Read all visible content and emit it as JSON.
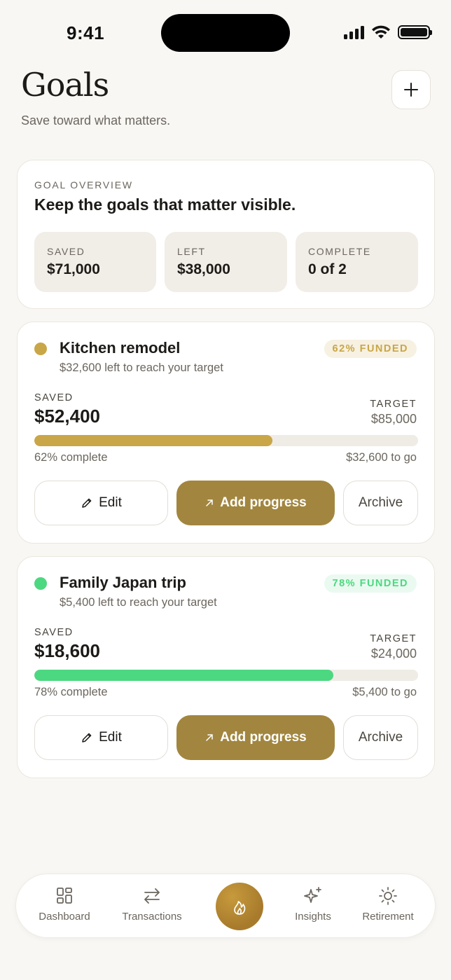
{
  "status": {
    "time": "9:41"
  },
  "header": {
    "title": "Goals",
    "subtitle": "Save toward what matters.",
    "add_icon": "plus-icon"
  },
  "overview": {
    "eyebrow": "GOAL OVERVIEW",
    "heading": "Keep the goals that matter visible.",
    "stats": [
      {
        "label": "SAVED",
        "value": "$71,000"
      },
      {
        "label": "LEFT",
        "value": "$38,000"
      },
      {
        "label": "COMPLETE",
        "value": "0 of 2"
      }
    ]
  },
  "goals": [
    {
      "name": "Kitchen remodel",
      "subtitle": "$32,600 left to reach your target",
      "badge": "62% FUNDED",
      "saved_label": "SAVED",
      "saved": "$52,400",
      "target_label": "TARGET",
      "target": "$85,000",
      "progress": 0.62,
      "progress_text": "62% complete",
      "remaining_text": "$32,600 to go",
      "color": "#c9a647",
      "badge_bg": "#f7f1e2",
      "badge_color": "#c9a647",
      "edit_label": "Edit",
      "add_label": "Add progress",
      "archive_label": "Archive"
    },
    {
      "name": "Family Japan trip",
      "subtitle": "$5,400 left to reach your target",
      "badge": "78% FUNDED",
      "saved_label": "SAVED",
      "saved": "$18,600",
      "target_label": "TARGET",
      "target": "$24,000",
      "progress": 0.78,
      "progress_text": "78% complete",
      "remaining_text": "$5,400 to go",
      "color": "#4cd880",
      "badge_bg": "#eafaf0",
      "badge_color": "#4cd880",
      "edit_label": "Edit",
      "add_label": "Add progress",
      "archive_label": "Archive"
    }
  ],
  "tabbar": {
    "items": [
      {
        "label": "Dashboard",
        "icon": "grid-icon"
      },
      {
        "label": "Transactions",
        "icon": "arrows-icon"
      },
      {
        "label": "",
        "icon": "flame-icon"
      },
      {
        "label": "Insights",
        "icon": "sparkle-icon"
      },
      {
        "label": "Retirement",
        "icon": "sun-icon"
      }
    ]
  },
  "colors": {
    "accent": "#a2863f",
    "background": "#f8f7f4"
  }
}
